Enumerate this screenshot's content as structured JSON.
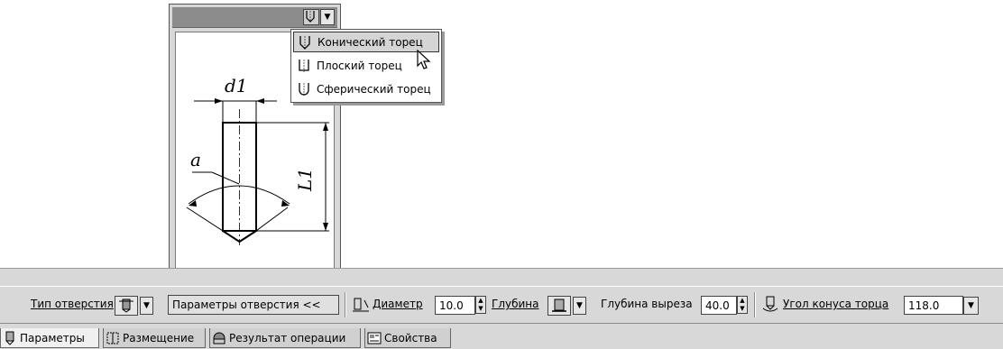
{
  "menu": {
    "items": [
      {
        "label": "Конический торец",
        "icon": "conical-end-icon",
        "selected": true
      },
      {
        "label": "Плоский торец",
        "icon": "flat-end-icon",
        "selected": false
      },
      {
        "label": "Сферический торец",
        "icon": "spherical-end-icon",
        "selected": false
      }
    ]
  },
  "drawing": {
    "labels": {
      "diameter": "d1",
      "length": "L1",
      "angle": "a"
    }
  },
  "toolbar": {
    "hole_type_label": "Тип отверстия",
    "params_button_label": "Параметры отверстия <<",
    "diameter_label": "Диаметр",
    "diameter_value": "10.0",
    "depth_label": "Глубина",
    "cut_depth_label": "Глубина выреза",
    "cut_depth_value": "40.0",
    "cone_angle_label": "Угол конуса торца",
    "cone_angle_value": "118.0"
  },
  "tabs": [
    {
      "label": "Параметры",
      "icon": "parameters-icon",
      "active": true
    },
    {
      "label": "Размещение",
      "icon": "placement-icon",
      "active": false
    },
    {
      "label": "Результат операции",
      "icon": "operation-result-icon",
      "active": false
    },
    {
      "label": "Свойства",
      "icon": "properties-icon",
      "active": false
    }
  ]
}
